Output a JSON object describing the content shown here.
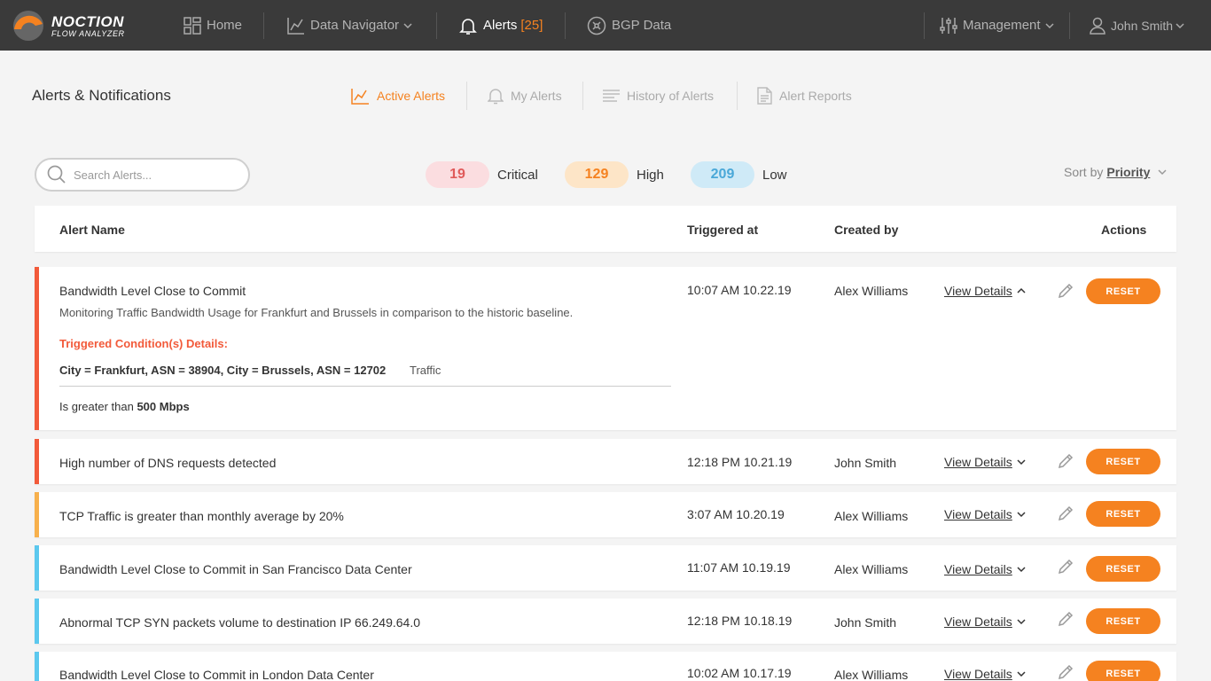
{
  "app": {
    "logo_title": "NOCTION",
    "logo_subtitle": "FLOW ANALYZER"
  },
  "nav": {
    "home": "Home",
    "data_navigator": "Data Navigator",
    "alerts": "Alerts",
    "alerts_count": "[25]",
    "bgp_data": "BGP Data",
    "management": "Management",
    "user": "John Smith"
  },
  "page": {
    "title": "Alerts & Notifications",
    "tabs": {
      "active_alerts": "Active Alerts",
      "my_alerts": "My Alerts",
      "history": "History of Alerts",
      "reports": "Alert Reports"
    }
  },
  "search": {
    "placeholder": "Search Alerts..."
  },
  "summary": {
    "critical_count": "19",
    "critical_label": "Critical",
    "high_count": "129",
    "high_label": "High",
    "low_count": "209",
    "low_label": "Low"
  },
  "sort": {
    "label": "Sort by",
    "value": "Priority"
  },
  "table": {
    "headers": {
      "name": "Alert Name",
      "triggered": "Triggered at",
      "created": "Created by",
      "actions": "Actions"
    },
    "view_details": "View Details",
    "reset": "RESET",
    "rows": [
      {
        "name": "Bandwidth Level Close to Commit",
        "time": "10:07 AM 10.22.19",
        "creator": "Alex Williams",
        "description": "Monitoring Traffic Bandwidth Usage for Frankfurt and Brussels in comparison to the historic baseline.",
        "condition_title": "Triggered Condition(s) Details:",
        "condition_expr": "City = Frankfurt, ASN = 38904, City = Brussels, ASN = 12702",
        "condition_metric": "Traffic",
        "threshold_text": "Is greater than",
        "threshold_value": "500 Mbps"
      },
      {
        "name": "High number of DNS requests detected",
        "time": "12:18 PM 10.21.19",
        "creator": "John Smith"
      },
      {
        "name": "TCP Traffic is greater than monthly average by 20%",
        "time": "3:07 AM 10.20.19",
        "creator": "Alex Williams"
      },
      {
        "name": "Bandwidth Level Close to Commit in San Francisco Data Center",
        "time": "11:07 AM 10.19.19",
        "creator": "Alex Williams"
      },
      {
        "name": "Abnormal TCP SYN packets volume to destination IP 66.249.64.0",
        "time": "12:18 PM 10.18.19",
        "creator": "John Smith"
      },
      {
        "name": "Bandwidth Level Close to Commit in London Data Center",
        "time": "10:02 AM 10.17.19",
        "creator": "Alex Williams"
      }
    ]
  },
  "colors": {
    "accent": "#f58220",
    "critical": "#f25a3a",
    "high": "#f7b04c",
    "low": "#5bc8ee"
  }
}
